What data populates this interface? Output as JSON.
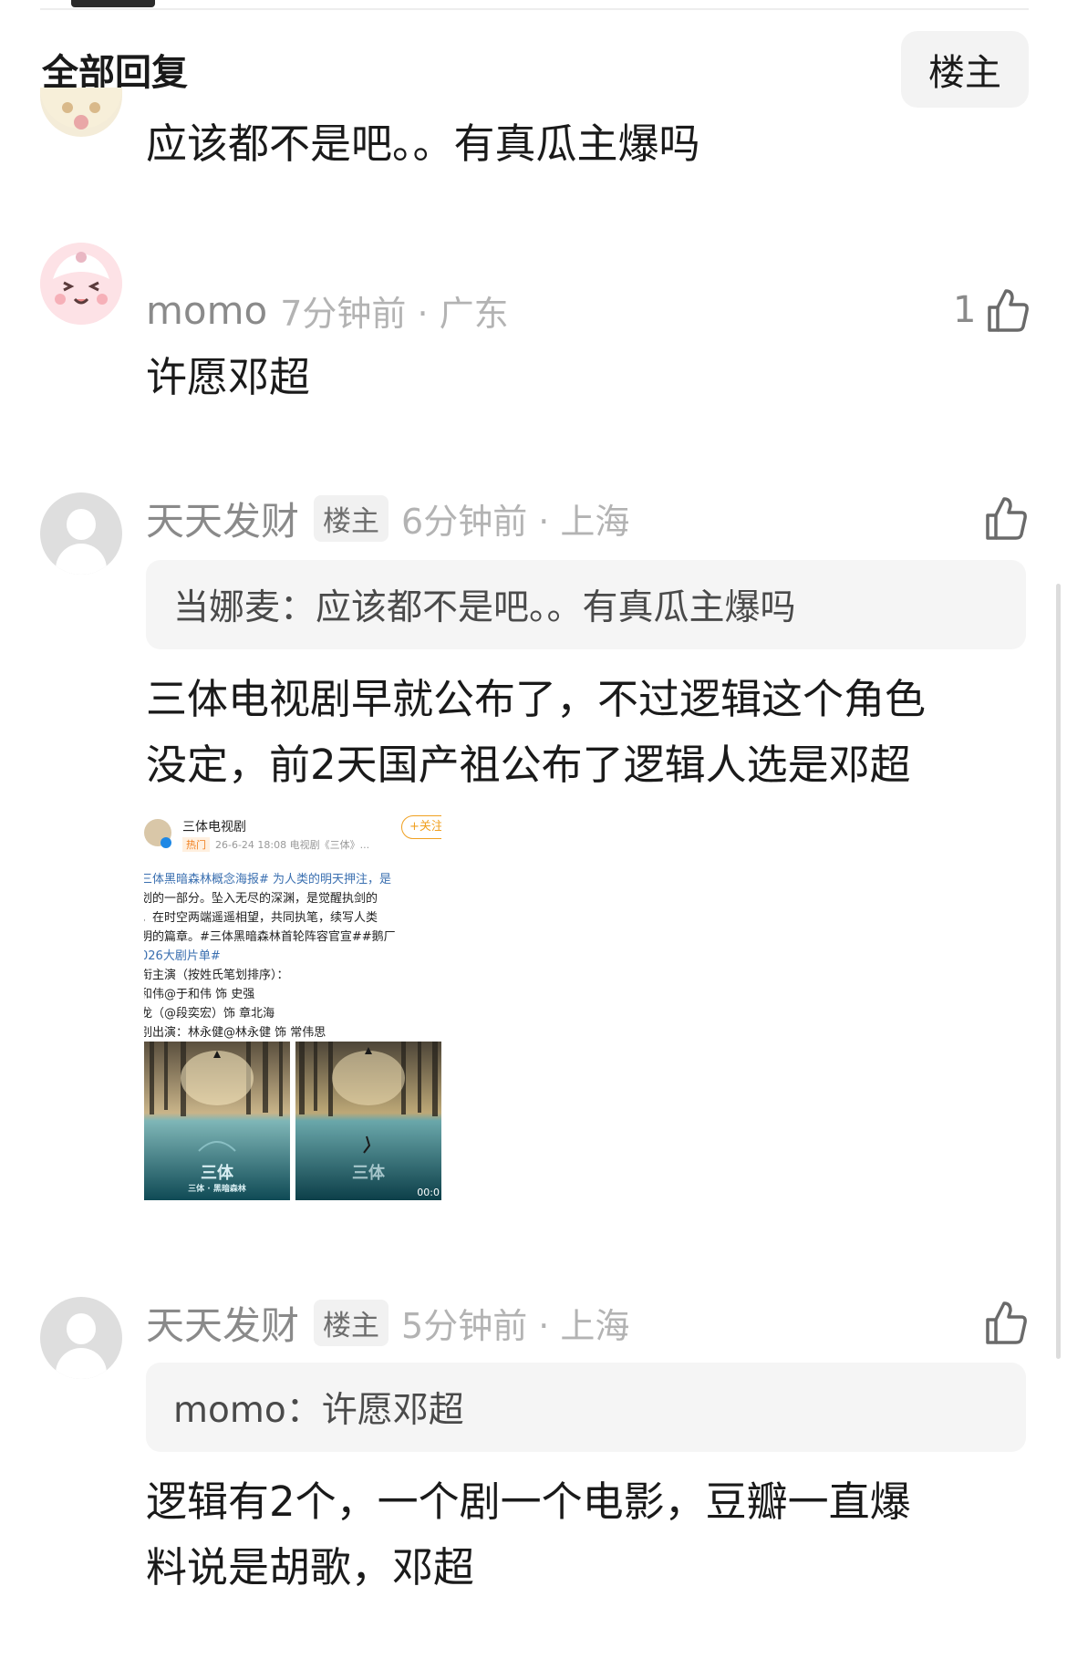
{
  "header": {
    "title": "全部回复",
    "owner_filter": "楼主"
  },
  "prev_comment": {
    "text": "应该都不是吧。。有真瓜主爆吗"
  },
  "comments": [
    {
      "username": "momo",
      "time_location": "7分钟前 · 广东",
      "like_count": "1",
      "text_lines": [
        "许愿邓超"
      ]
    },
    {
      "username": "天天发财",
      "badge": "楼主",
      "time_location": "6分钟前 · 上海",
      "like_count": "",
      "quote": "当娜麦：应该都不是吧。。有真瓜主爆吗",
      "text_lines": [
        "三体电视剧早就公布了，不过逻辑这个角色",
        "没定，前2天国产祖公布了逻辑人选是邓超"
      ],
      "embed": {
        "account_name": "三体电视剧",
        "follow_label": "+关注",
        "hot_label": "热门",
        "meta": "26-6-24 18:08  电视剧《三体》...",
        "lines": [
          "三体黑暗森林概念海报# 为人类的明天押注，是",
          "划的一部分。坠入无尽的深渊，是觉醒执剑的",
          "。在时空两端遥遥相望，共同执笔，续写人类",
          "明的篇章。#三体黑暗森林首轮阵容官宣##鹅厂",
          "026大剧片单#",
          "衔主演（按姓氏笔划排序）：",
          "和伟@于和伟 饰 史强",
          "龙（@段奕宏）饰 章北海",
          "别出演：林永健@林永健 饰 常伟思"
        ],
        "poster_title": "三体",
        "poster_subtitle": "三体 · 黑暗森林",
        "video_time": "00:0"
      }
    },
    {
      "username": "天天发财",
      "badge": "楼主",
      "time_location": "5分钟前 · 上海",
      "like_count": "",
      "quote": "momo：许愿邓超",
      "text_lines": [
        "逻辑有2个，一个剧一个电影，豆瓣一直爆",
        "料说是胡歌，邓超"
      ]
    }
  ],
  "colors": {
    "text": "#1a1a1a",
    "meta": "#b3b3b3",
    "username": "#8a8a8a",
    "quote_bg": "#f5f5f5"
  },
  "icons": {
    "like": "thumbs-up-icon",
    "avatar_placeholder": "user-silhouette-icon"
  }
}
